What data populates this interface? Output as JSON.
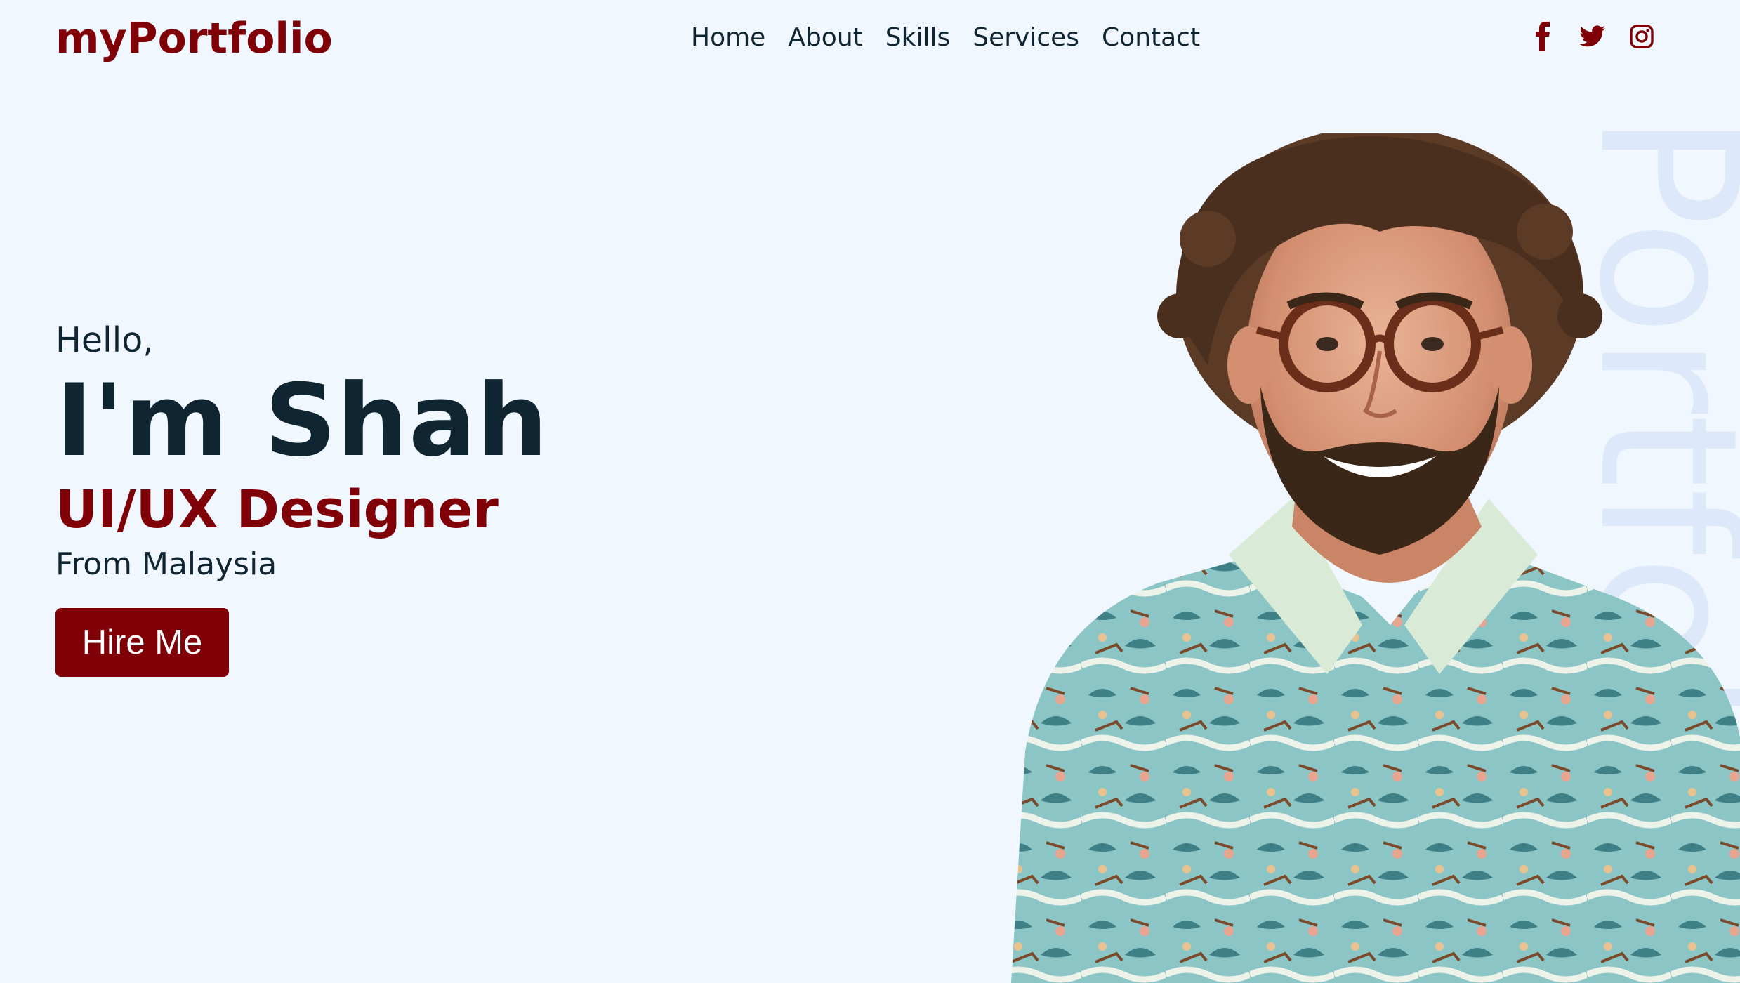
{
  "header": {
    "logo": "myPortfolio",
    "nav": [
      {
        "label": "Home"
      },
      {
        "label": "About"
      },
      {
        "label": "Skills"
      },
      {
        "label": "Services"
      },
      {
        "label": "Contact"
      }
    ],
    "socials": [
      {
        "icon": "facebook-icon"
      },
      {
        "icon": "twitter-icon"
      },
      {
        "icon": "instagram-icon"
      }
    ]
  },
  "hero": {
    "greeting": "Hello,",
    "name": "I'm Shah",
    "role": "UI/UX Designer",
    "origin": "From Malaysia",
    "cta": "Hire Me",
    "watermark": "Portfolio"
  },
  "colors": {
    "brand": "#800008",
    "text": "#0f2532",
    "background": "#f1f7fe",
    "watermark": "#dde9fb"
  }
}
